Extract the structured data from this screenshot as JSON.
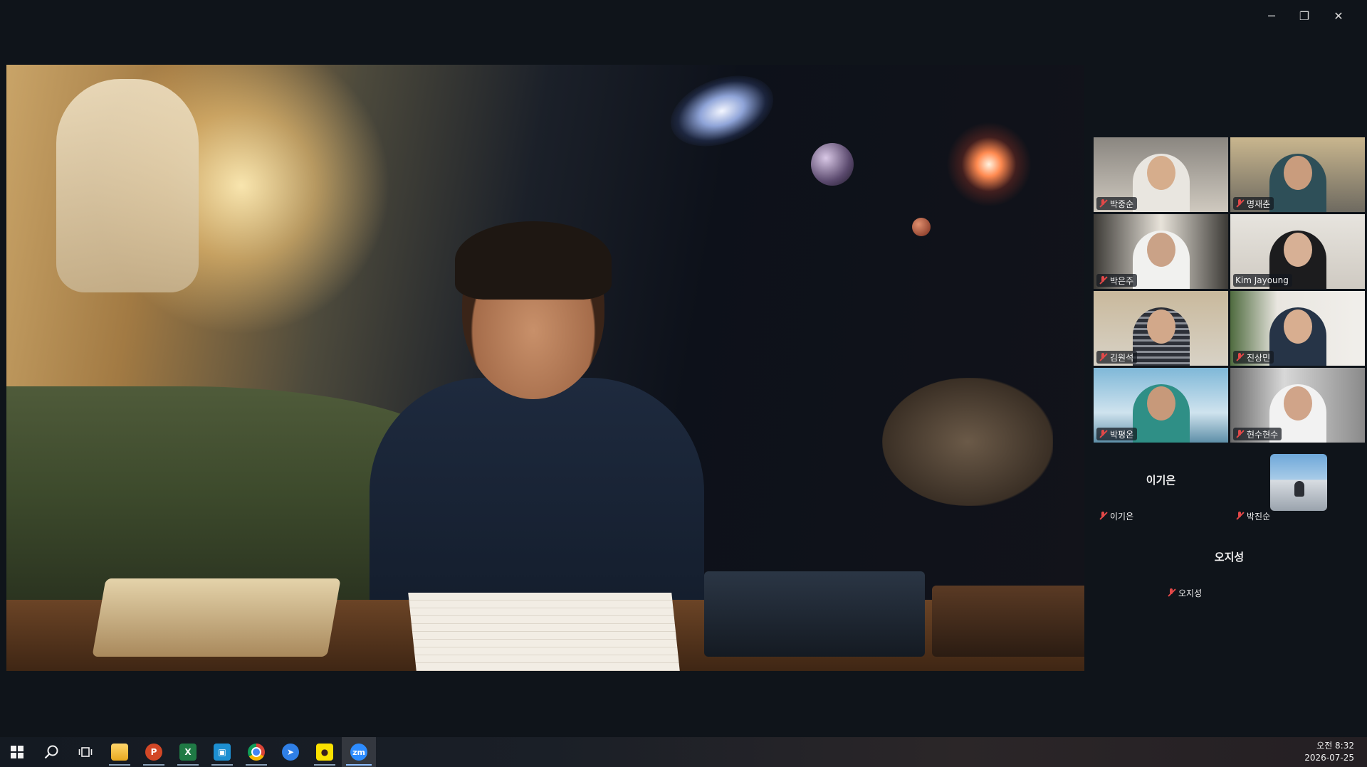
{
  "window": {
    "minimize": "─",
    "restore": "❐",
    "close": "✕"
  },
  "participants_grid": [
    {
      "name": "박중순",
      "active": false
    },
    {
      "name": "명재춘",
      "active": false
    },
    {
      "name": "박은주",
      "active": false
    },
    {
      "name": "Kim Jayoung",
      "active": true
    },
    {
      "name": "김원석",
      "active": false
    },
    {
      "name": "진상민",
      "active": false
    },
    {
      "name": "박평온",
      "active": false
    },
    {
      "name": "현수현수",
      "active": false
    }
  ],
  "cards": {
    "lee": {
      "big_name": "이기은",
      "name": "이기은"
    },
    "park": {
      "name": "박진순"
    },
    "oh": {
      "big_name": "오지성",
      "name": "오지성"
    }
  },
  "taskbar": {
    "icons": [
      "windows-start",
      "search",
      "task-view",
      "file-explorer",
      "powerpoint",
      "excel",
      "store-app",
      "chrome",
      "arrow-app",
      "kakaotalk",
      "zoom"
    ],
    "zoom_label": "zm",
    "clock_time": "오전 8:32",
    "clock_date": "2026-07-25"
  },
  "colors": {
    "active_speaker": "#3ccc70",
    "mic_muted": "#e24848",
    "background": "#0f141a"
  }
}
